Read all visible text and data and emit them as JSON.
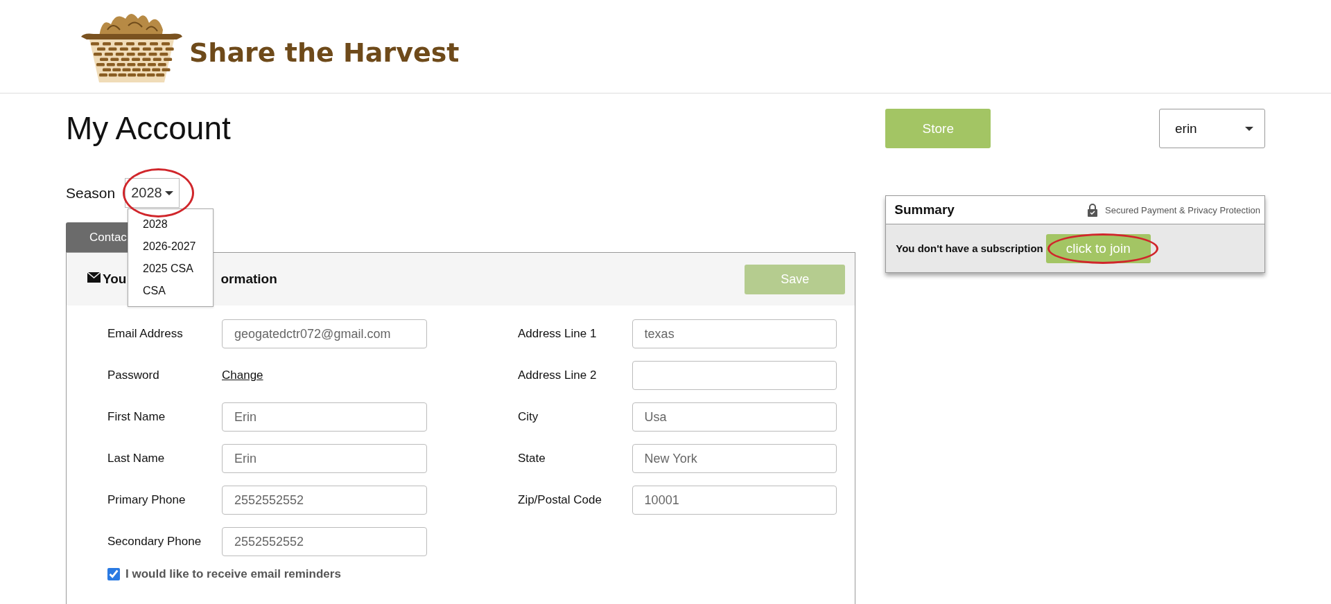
{
  "header": {
    "brand": "Share the Harvest"
  },
  "page": {
    "title": "My Account"
  },
  "toolbar": {
    "store_button": "Store",
    "user_select": "erin"
  },
  "season": {
    "label": "Season",
    "value": "2028",
    "options": [
      {
        "label": "2028"
      },
      {
        "label": "2026-2027"
      },
      {
        "label": "2025 CSA"
      },
      {
        "label": "CSA"
      }
    ]
  },
  "tabs": [
    {
      "label": "Contac",
      "selected": true
    }
  ],
  "section": {
    "title_parts": [
      "You",
      "ormation"
    ],
    "save_button": {
      "label": "Save",
      "disabled": true
    }
  },
  "form": {
    "left": [
      {
        "kind": "input",
        "label": "Email Address",
        "value": "geogatedctr072@gmail.com"
      },
      {
        "kind": "link",
        "label": "Password",
        "value": "Change"
      },
      {
        "kind": "input",
        "label": "First Name",
        "value": "Erin"
      },
      {
        "kind": "input",
        "label": "Last Name",
        "value": "Erin"
      },
      {
        "kind": "input",
        "label": "Primary Phone",
        "value": "2552552552"
      },
      {
        "kind": "input",
        "label": "Secondary Phone",
        "value": "2552552552"
      }
    ],
    "right": [
      {
        "kind": "input",
        "label": "Address Line 1",
        "value": "texas"
      },
      {
        "kind": "input",
        "label": "Address Line 2"
      },
      {
        "kind": "input",
        "label": "City",
        "value": "Usa"
      },
      {
        "kind": "input",
        "label": "State",
        "value": "New York"
      },
      {
        "kind": "input",
        "label": "Zip/Postal Code",
        "value": "10001"
      }
    ],
    "reminders": {
      "label": "I would like to receive email reminders",
      "checked": true
    }
  },
  "summary": {
    "title": "Summary",
    "security_note": "Secured Payment & Privacy Protection",
    "message": "You don't have a subscription",
    "join_button": "click to join"
  }
}
